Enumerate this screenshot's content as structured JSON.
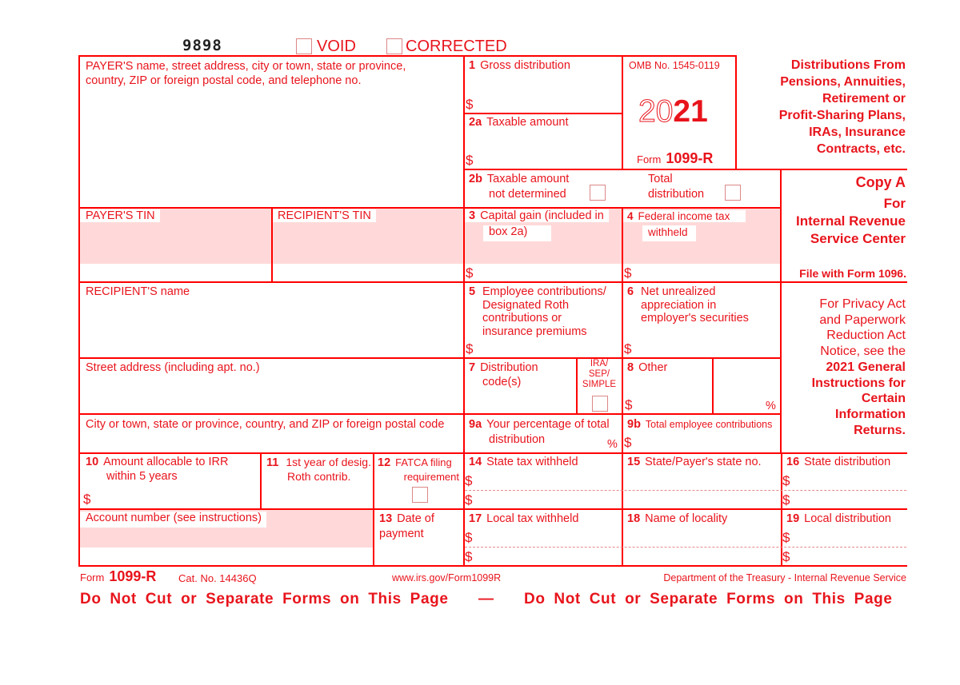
{
  "header": {
    "form_code": "9898",
    "void_label": "VOID",
    "corrected_label": "CORRECTED"
  },
  "payer": {
    "name_label_line1": "PAYER'S name, street address, city or town, state or province,",
    "name_label_line2": "country, ZIP or foreign postal code, and telephone no.",
    "tin_label": "PAYER'S TIN"
  },
  "recipient": {
    "tin_label": "RECIPIENT'S TIN",
    "name_label": "RECIPIENT'S name",
    "street_label": "Street address (including apt. no.)",
    "city_label": "City or town, state or province, country, and ZIP or foreign postal code",
    "account_label": "Account number (see instructions)"
  },
  "omb": {
    "omb_no": "OMB No. 1545-0119",
    "year_outline": "20",
    "year_bold": "21",
    "form_word": "Form",
    "form_name": "1099-R"
  },
  "title": {
    "lines": [
      "Distributions From",
      "Pensions, Annuities,",
      "Retirement or",
      "Profit-Sharing Plans,",
      "IRAs, Insurance",
      "Contracts, etc."
    ]
  },
  "copy": {
    "copy_label": "Copy A",
    "for_label": "For",
    "irs_line1": "Internal Revenue",
    "irs_line2": "Service Center",
    "file_with": "File with Form 1096."
  },
  "privacy": {
    "lines": [
      "For Privacy Act",
      "and Paperwork",
      "Reduction Act",
      "Notice, see the"
    ],
    "bold_lines": [
      "2021 General",
      "Instructions for",
      "Certain",
      "Information",
      "Returns."
    ]
  },
  "symbols": {
    "dollar": "$",
    "percent": "%"
  },
  "boxes": {
    "b1": {
      "num": "1",
      "label": "Gross distribution"
    },
    "b2a": {
      "num": "2a",
      "label": "Taxable amount"
    },
    "b2b": {
      "num": "2b",
      "label_line1": "Taxable amount",
      "label_line2": "not determined"
    },
    "total_dist": {
      "label_line1": "Total",
      "label_line2": "distribution"
    },
    "b3": {
      "num": "3",
      "label_line1": "Capital gain (included in",
      "label_line2": "box 2a)"
    },
    "b4": {
      "num": "4",
      "label_line1": "Federal income tax",
      "label_line2": "withheld"
    },
    "b5": {
      "num": "5",
      "lines": [
        "Employee contributions/",
        "Designated Roth",
        "contributions or",
        "insurance premiums"
      ]
    },
    "b6": {
      "num": "6",
      "lines": [
        "Net unrealized",
        "appreciation in",
        "employer's securities"
      ]
    },
    "b7": {
      "num": "7",
      "label_line1": "Distribution",
      "label_line2": "code(s)"
    },
    "ira": {
      "lines": [
        "IRA/",
        "SEP/",
        "SIMPLE"
      ]
    },
    "b8": {
      "num": "8",
      "label": "Other"
    },
    "b9a": {
      "num": "9a",
      "label_line1": "Your percentage of total",
      "label_line2": "distribution"
    },
    "b9b": {
      "num": "9b",
      "label": "Total employee contributions"
    },
    "b10": {
      "num": "10",
      "label_line1": "Amount allocable to IRR",
      "label_line2": "within 5 years"
    },
    "b11": {
      "num": "11",
      "label_line1": "1st year of desig.",
      "label_line2": "Roth contrib."
    },
    "b12": {
      "num": "12",
      "label_line1": "FATCA filing",
      "label_line2": "requirement"
    },
    "b13": {
      "num": "13",
      "label_line1": "Date of",
      "label_line2": "payment"
    },
    "b14": {
      "num": "14",
      "label": "State tax withheld"
    },
    "b15": {
      "num": "15",
      "label": "State/Payer's state no."
    },
    "b16": {
      "num": "16",
      "label": "State distribution"
    },
    "b17": {
      "num": "17",
      "label": "Local tax withheld"
    },
    "b18": {
      "num": "18",
      "label": "Name of locality"
    },
    "b19": {
      "num": "19",
      "label": "Local distribution"
    }
  },
  "footer": {
    "form_word": "Form",
    "form_name": "1099-R",
    "cat_no": "Cat. No. 14436Q",
    "url": "www.irs.gov/Form1099R",
    "department": "Department of the Treasury - Internal Revenue Service",
    "warning_left": "Do Not Cut or Separate Forms on This Page",
    "dash": "—",
    "warning_right": "Do Not Cut or Separate Forms on This Page"
  }
}
